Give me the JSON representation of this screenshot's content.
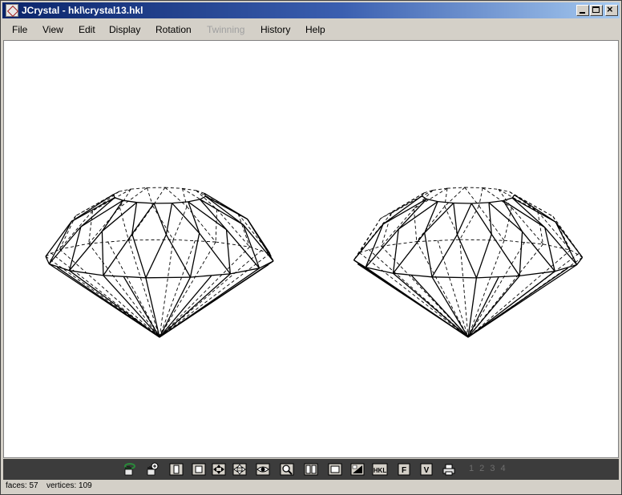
{
  "window": {
    "title": "JCrystal - hkl\\crystal13.hkl"
  },
  "menu": [
    {
      "label": "File",
      "enabled": true
    },
    {
      "label": "View",
      "enabled": true
    },
    {
      "label": "Edit",
      "enabled": true
    },
    {
      "label": "Display",
      "enabled": true
    },
    {
      "label": "Rotation",
      "enabled": true
    },
    {
      "label": "Twinning",
      "enabled": false
    },
    {
      "label": "History",
      "enabled": true
    },
    {
      "label": "Help",
      "enabled": true
    }
  ],
  "toolbar": {
    "tools": [
      {
        "icon": "rotate-hand-icon"
      },
      {
        "icon": "zoom-hand-icon"
      },
      {
        "icon": "frame-icon"
      },
      {
        "icon": "square-icon"
      },
      {
        "icon": "move-arrows-icon"
      },
      {
        "icon": "move-arrows-alt-icon"
      },
      {
        "icon": "eye-icon"
      },
      {
        "icon": "magnifier-icon"
      },
      {
        "icon": "stereo-icon"
      },
      {
        "icon": "box-icon"
      },
      {
        "icon": "shading-icon"
      },
      {
        "icon": "hkl-icon",
        "label": "HKL"
      },
      {
        "icon": "faces-icon",
        "label": "F"
      },
      {
        "icon": "vertices-icon",
        "label": "V"
      },
      {
        "icon": "print-icon"
      }
    ],
    "pages": "1 2 3 4"
  },
  "status": {
    "faces": "faces: 57",
    "vertices": "vertices: 109"
  },
  "colors": {
    "title_start": "#0a246a",
    "title_end": "#a6caf0",
    "toolbar_bg": "#3c3c3c",
    "canvas_bg": "#ffffff",
    "disabled_text": "#a0a0a0"
  }
}
